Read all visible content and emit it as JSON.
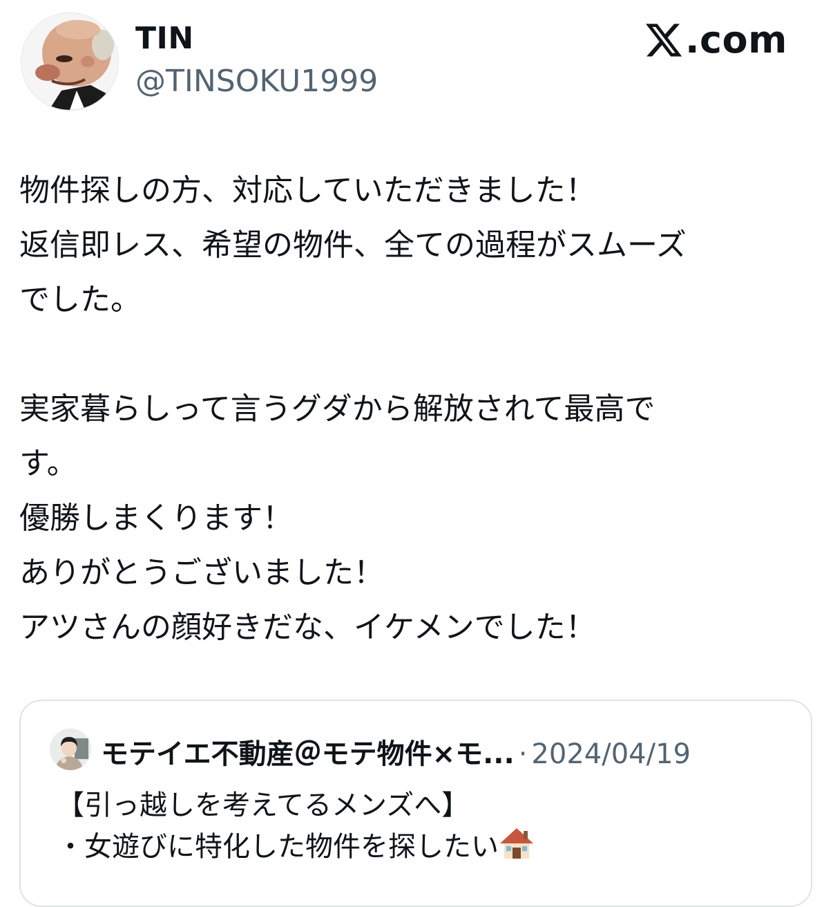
{
  "tweet": {
    "author_name": "TIN",
    "author_handle": "@TINSOKU1999",
    "avatar_icon": "bald-man-avatar-icon",
    "lines": [
      "物件探しの方、対応していただきました！",
      "返信即レス、希望の物件、全ての過程がスムーズ",
      "でした。",
      "",
      "実家暮らしって言うグダから解放されて最高で",
      "す。",
      "優勝しまくります！",
      "ありがとうございました！",
      "アツさんの顔好きだな、イケメンでした！"
    ]
  },
  "brand": {
    "logo_icon": "x-logo-icon",
    "label": ".com"
  },
  "quoted": {
    "author_name": "モテイエ不動産＠モテ物件×モ...",
    "separator": "·",
    "date": "2024/04/19",
    "avatar_icon": "young-man-avatar-icon",
    "line1": "【引っ越しを考えてるメンズへ】",
    "line2": "・女遊びに特化した物件を探したい",
    "line2_emoji": "house-emoji-icon"
  }
}
